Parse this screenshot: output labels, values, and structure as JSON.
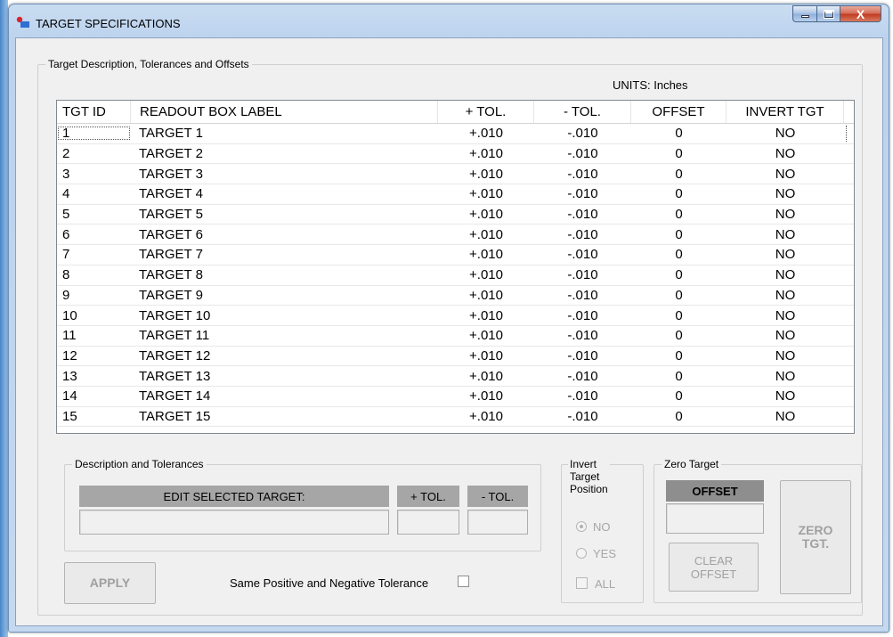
{
  "window": {
    "title": "TARGET SPECIFICATIONS",
    "close_glyph": "X"
  },
  "targets_group": {
    "label": "Target Description, Tolerances and Offsets",
    "units": "UNITS: Inches"
  },
  "table": {
    "columns": [
      "TGT ID",
      "READOUT BOX LABEL",
      "+ TOL.",
      "- TOL.",
      "OFFSET",
      "INVERT TGT"
    ],
    "rows": [
      {
        "id": "1",
        "label": "TARGET 1",
        "ptol": "+.010",
        "ntol": "-.010",
        "offset": "0",
        "invert": "NO"
      },
      {
        "id": "2",
        "label": "TARGET 2",
        "ptol": "+.010",
        "ntol": "-.010",
        "offset": "0",
        "invert": "NO"
      },
      {
        "id": "3",
        "label": "TARGET 3",
        "ptol": "+.010",
        "ntol": "-.010",
        "offset": "0",
        "invert": "NO"
      },
      {
        "id": "4",
        "label": "TARGET 4",
        "ptol": "+.010",
        "ntol": "-.010",
        "offset": "0",
        "invert": "NO"
      },
      {
        "id": "5",
        "label": "TARGET 5",
        "ptol": "+.010",
        "ntol": "-.010",
        "offset": "0",
        "invert": "NO"
      },
      {
        "id": "6",
        "label": "TARGET 6",
        "ptol": "+.010",
        "ntol": "-.010",
        "offset": "0",
        "invert": "NO"
      },
      {
        "id": "7",
        "label": "TARGET 7",
        "ptol": "+.010",
        "ntol": "-.010",
        "offset": "0",
        "invert": "NO"
      },
      {
        "id": "8",
        "label": "TARGET 8",
        "ptol": "+.010",
        "ntol": "-.010",
        "offset": "0",
        "invert": "NO"
      },
      {
        "id": "9",
        "label": "TARGET 9",
        "ptol": "+.010",
        "ntol": "-.010",
        "offset": "0",
        "invert": "NO"
      },
      {
        "id": "10",
        "label": "TARGET 10",
        "ptol": "+.010",
        "ntol": "-.010",
        "offset": "0",
        "invert": "NO"
      },
      {
        "id": "11",
        "label": "TARGET 11",
        "ptol": "+.010",
        "ntol": "-.010",
        "offset": "0",
        "invert": "NO"
      },
      {
        "id": "12",
        "label": "TARGET 12",
        "ptol": "+.010",
        "ntol": "-.010",
        "offset": "0",
        "invert": "NO"
      },
      {
        "id": "13",
        "label": "TARGET 13",
        "ptol": "+.010",
        "ntol": "-.010",
        "offset": "0",
        "invert": "NO"
      },
      {
        "id": "14",
        "label": "TARGET 14",
        "ptol": "+.010",
        "ntol": "-.010",
        "offset": "0",
        "invert": "NO"
      },
      {
        "id": "15",
        "label": "TARGET 15",
        "ptol": "+.010",
        "ntol": "-.010",
        "offset": "0",
        "invert": "NO"
      }
    ]
  },
  "desc_group": {
    "label": "Description and Tolerances",
    "edit_header": "EDIT SELECTED TARGET:",
    "edit_value": "",
    "ptol_header": "+ TOL.",
    "ptol_value": "",
    "ntol_header": "- TOL.",
    "ntol_value": ""
  },
  "invert_group": {
    "label_line1": "Invert",
    "label_line2": "Target",
    "label_line3": "Position",
    "no_label": "NO",
    "yes_label": "YES",
    "all_label": "ALL"
  },
  "zero_group": {
    "label": "Zero Target",
    "offset_header": "OFFSET",
    "offset_value": "",
    "clear_line1": "CLEAR",
    "clear_line2": "OFFSET",
    "zero_line1": "ZERO",
    "zero_line2": "TGT."
  },
  "bottom": {
    "apply_label": "APPLY",
    "same_tol_label": "Same Positive and Negative Tolerance"
  }
}
